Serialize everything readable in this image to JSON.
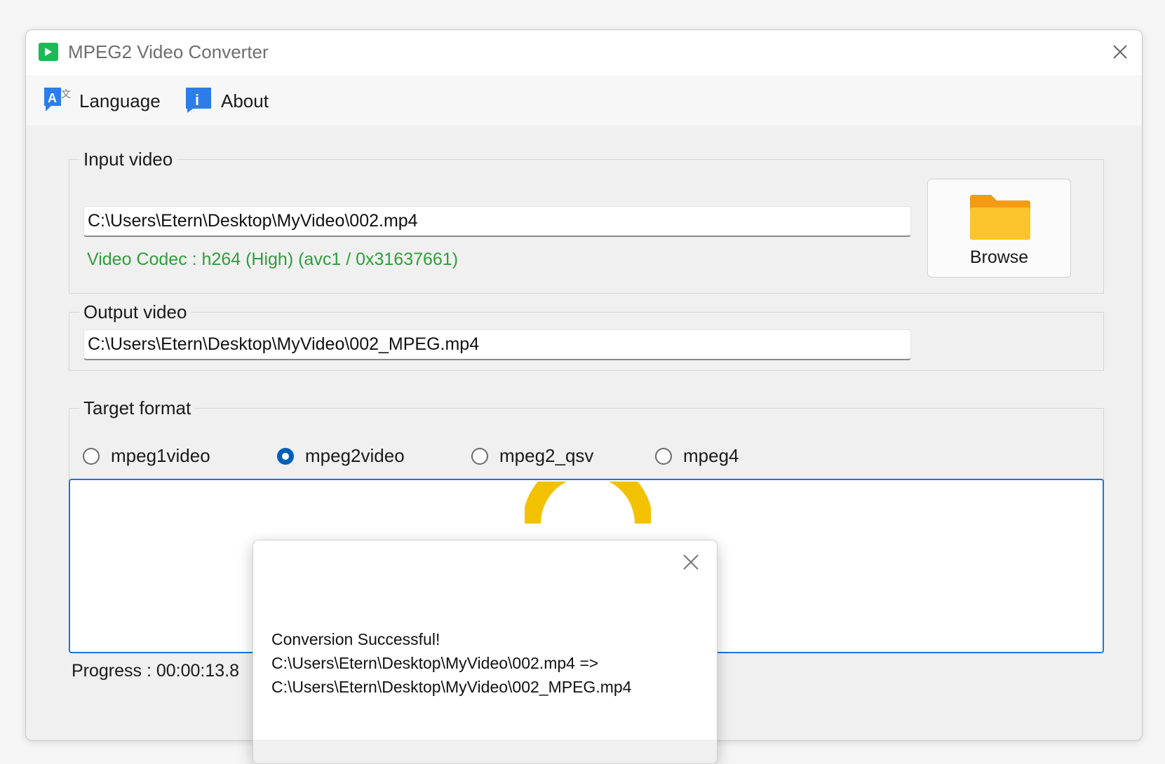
{
  "window": {
    "title": "MPEG2 Video Converter"
  },
  "menu": {
    "language": "Language",
    "about": "About"
  },
  "input": {
    "legend": "Input video",
    "path": "C:\\Users\\Etern\\Desktop\\MyVideo\\002.mp4",
    "codec_info": "Video Codec : h264 (High) (avc1 / 0x31637661)",
    "browse_label": "Browse"
  },
  "output": {
    "legend": "Output video",
    "path": "C:\\Users\\Etern\\Desktop\\MyVideo\\002_MPEG.mp4"
  },
  "format": {
    "legend": "Target format",
    "options": [
      "mpeg1video",
      "mpeg2video",
      "mpeg2_qsv",
      "mpeg4"
    ],
    "selected": "mpeg2video"
  },
  "progress": {
    "text": "Progress : 00:00:13.8"
  },
  "dialog": {
    "line1": "Conversion Successful!",
    "line2": " C:\\Users\\Etern\\Desktop\\MyVideo\\002.mp4 =>",
    "line3": "C:\\Users\\Etern\\Desktop\\MyVideo\\002_MPEG.mp4"
  },
  "colors": {
    "accent": "#005fb8",
    "success_text": "#2e9e3a",
    "folder": "#f9b81b",
    "spinner": "#f2c200",
    "app_icon": "#1db954"
  }
}
